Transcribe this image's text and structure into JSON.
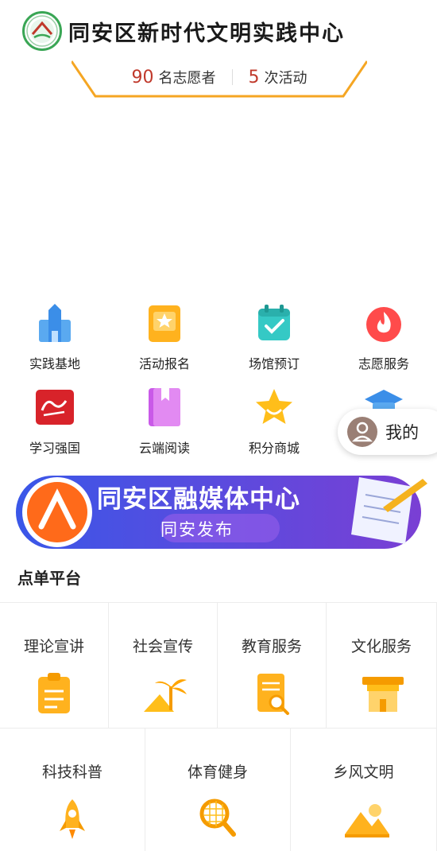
{
  "header": {
    "title": "同安区新时代文明实践中心"
  },
  "stats": {
    "volunteers_num": "90",
    "volunteers_label": "名志愿者",
    "activities_num": "5",
    "activities_label": "次活动"
  },
  "grid": [
    {
      "label": "实践基地",
      "icon": "building-icon"
    },
    {
      "label": "活动报名",
      "icon": "star-card-icon"
    },
    {
      "label": "场馆预订",
      "icon": "calendar-check-icon"
    },
    {
      "label": "志愿服务",
      "icon": "flame-icon"
    },
    {
      "label": "学习强国",
      "icon": "xuexi-icon"
    },
    {
      "label": "云端阅读",
      "icon": "book-icon"
    },
    {
      "label": "积分商城",
      "icon": "star-icon"
    },
    {
      "label": "",
      "icon": "graduation-cap-icon"
    }
  ],
  "mine": {
    "label": "我的"
  },
  "media_banner": {
    "title": "同安区融媒体中心",
    "subtitle": "同安发布"
  },
  "order_platform": {
    "title": "点单平台",
    "items": [
      {
        "label": "理论宣讲",
        "icon": "clipboard-icon"
      },
      {
        "label": "社会宣传",
        "icon": "palm-tree-icon"
      },
      {
        "label": "教育服务",
        "icon": "document-search-icon"
      },
      {
        "label": "文化服务",
        "icon": "pavilion-icon"
      },
      {
        "label": "科技科普",
        "icon": "rocket-icon"
      },
      {
        "label": "体育健身",
        "icon": "racket-icon"
      },
      {
        "label": "乡风文明",
        "icon": "mountain-icon"
      }
    ]
  },
  "colors": {
    "accent_orange": "#f5a623",
    "stat_red": "#c0392b",
    "banner_purple": "#6b3fd6",
    "banner_blue": "#3a57e8"
  }
}
